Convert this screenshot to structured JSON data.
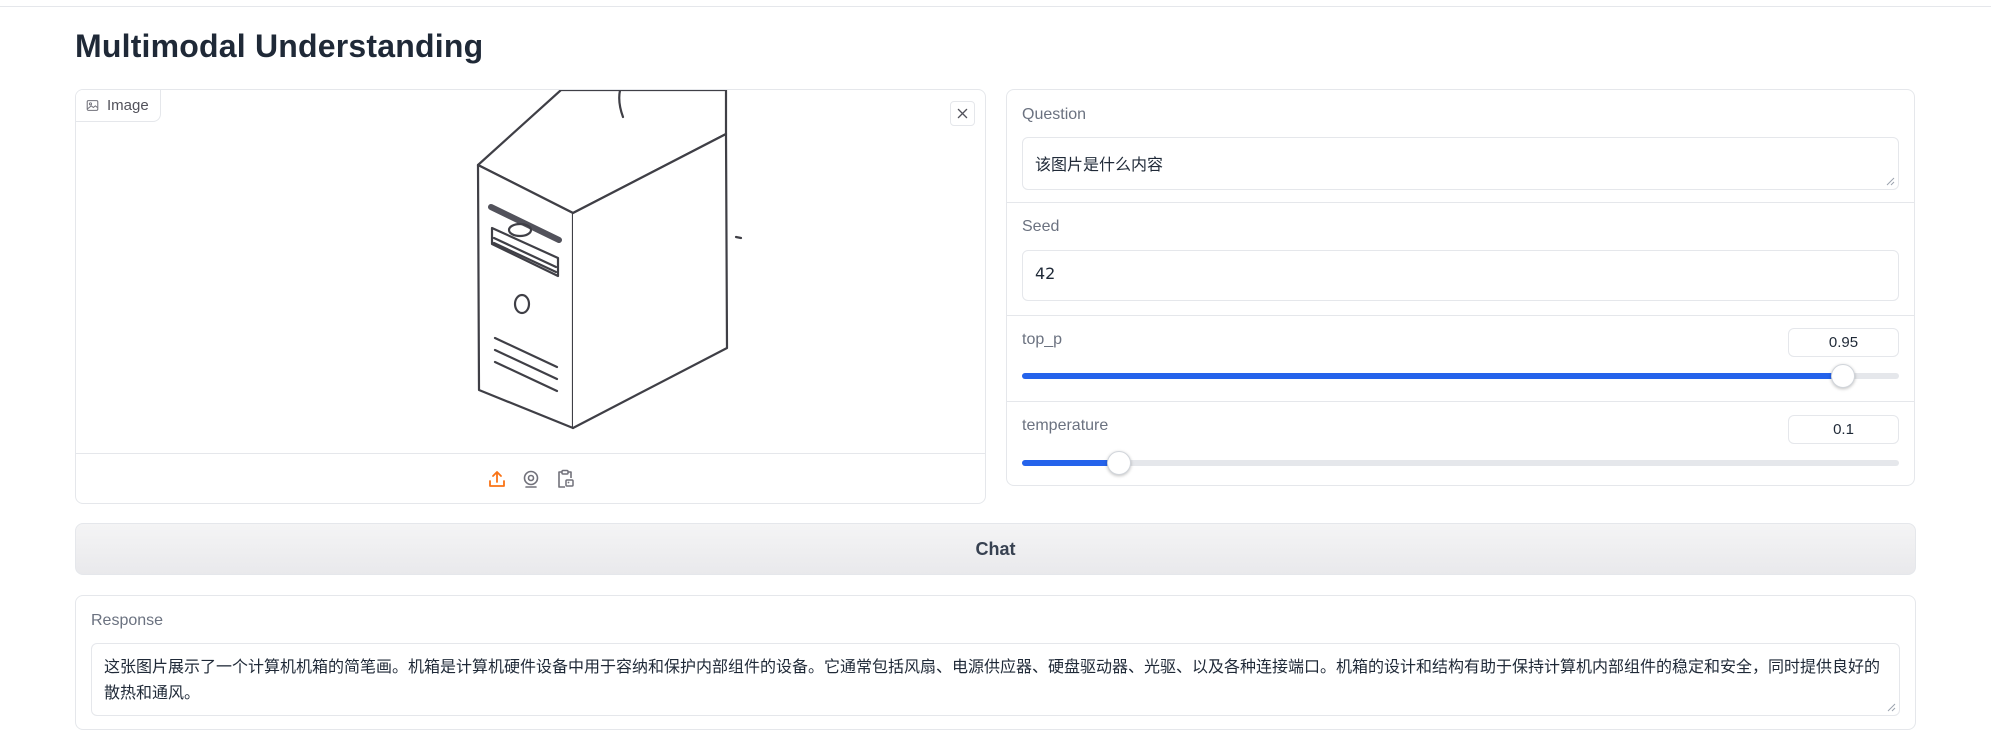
{
  "page": {
    "title": "Multimodal Understanding"
  },
  "image_panel": {
    "label": "Image",
    "image_icon": "image-icon",
    "clear_icon": "close-icon",
    "toolbar_icons": [
      "upload-icon",
      "webcam-icon",
      "clipboard-paste-icon"
    ]
  },
  "question": {
    "label": "Question",
    "value": "该图片是什么内容"
  },
  "seed": {
    "label": "Seed",
    "value": "42"
  },
  "top_p": {
    "label": "top_p",
    "value": "0.95",
    "fraction": 0.95
  },
  "temperature": {
    "label": "temperature",
    "value": "0.1",
    "fraction": 0.1
  },
  "chat_button": {
    "label": "Chat"
  },
  "response": {
    "label": "Response",
    "value": "这张图片展示了一个计算机机箱的简笔画。机箱是计算机硬件设备中用于容纳和保护内部组件的设备。它通常包括风扇、电源供应器、硬盘驱动器、光驱、以及各种连接端口。机箱的设计和结构有助于保持计算机内部组件的稳定和安全，同时提供良好的散热和通风。"
  },
  "colors": {
    "accent": "#2563eb",
    "upload_accent": "#f97316",
    "border": "#e5e7eb"
  }
}
